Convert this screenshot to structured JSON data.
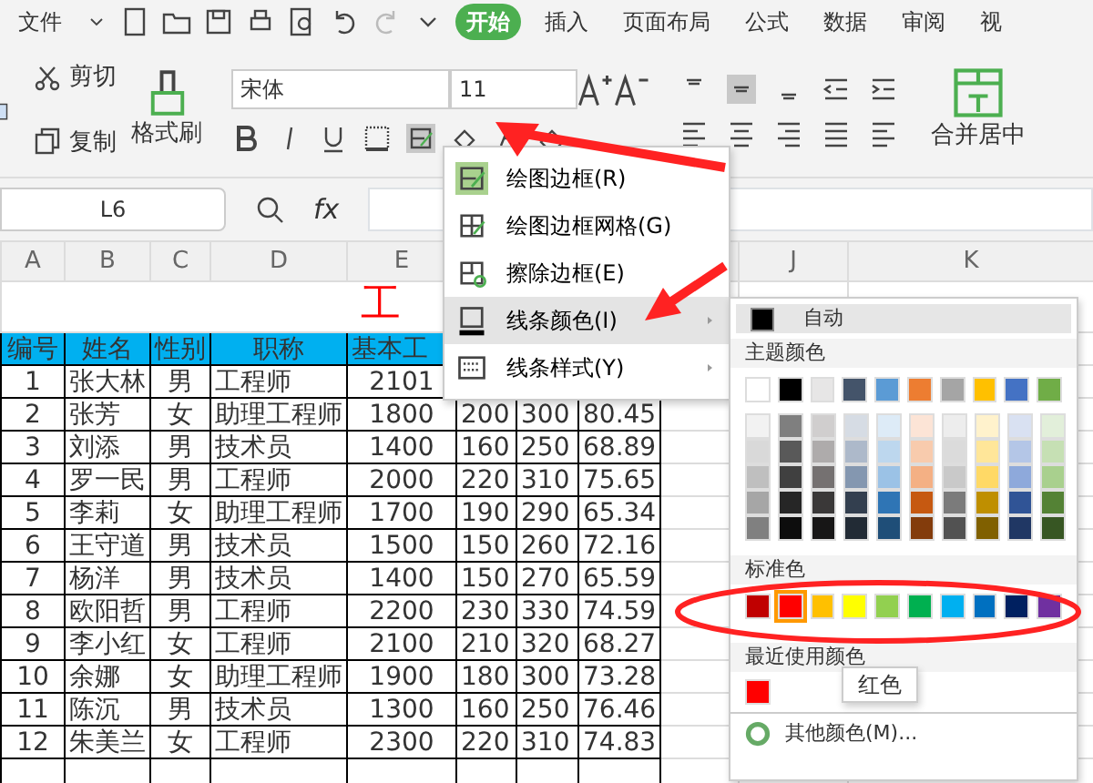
{
  "file_menu": "文件",
  "tabs": [
    {
      "label": "开始",
      "selected": true
    },
    {
      "label": "插入",
      "selected": false
    },
    {
      "label": "页面布局",
      "selected": false
    },
    {
      "label": "公式",
      "selected": false
    },
    {
      "label": "数据",
      "selected": false
    },
    {
      "label": "审阅",
      "selected": false
    },
    {
      "label": "视",
      "selected": false
    }
  ],
  "clipboard": {
    "cut": "剪切",
    "copy": "复制",
    "format_painter": "格式刷"
  },
  "font": {
    "name": "宋体",
    "size": "11"
  },
  "merge": "合并居中",
  "name_box": "L6",
  "fx": "fx",
  "columns": [
    "A",
    "B",
    "C",
    "D",
    "E",
    "J",
    "K"
  ],
  "sheet": {
    "title": "工",
    "headers": [
      "编号",
      "姓名",
      "性别",
      "职称",
      "基本工"
    ],
    "rows": [
      [
        "1",
        "张大林",
        "男",
        "工程师",
        "2101",
        "",
        "",
        ""
      ],
      [
        "2",
        "张芳",
        "女",
        "助理工程师",
        "1800",
        "200",
        "300",
        "80.45"
      ],
      [
        "3",
        "刘添",
        "男",
        "技术员",
        "1400",
        "160",
        "250",
        "68.89"
      ],
      [
        "4",
        "罗一民",
        "男",
        "工程师",
        "2000",
        "220",
        "310",
        "75.65"
      ],
      [
        "5",
        "李莉",
        "女",
        "助理工程师",
        "1700",
        "190",
        "290",
        "65.34"
      ],
      [
        "6",
        "王守道",
        "男",
        "技术员",
        "1500",
        "150",
        "260",
        "72.16"
      ],
      [
        "7",
        "杨洋",
        "男",
        "技术员",
        "1400",
        "150",
        "270",
        "65.59"
      ],
      [
        "8",
        "欧阳哲",
        "男",
        "工程师",
        "2200",
        "230",
        "330",
        "74.59"
      ],
      [
        "9",
        "李小红",
        "女",
        "工程师",
        "2100",
        "210",
        "320",
        "68.27"
      ],
      [
        "10",
        "余娜",
        "女",
        "助理工程师",
        "1900",
        "180",
        "300",
        "73.28"
      ],
      [
        "11",
        "陈沉",
        "男",
        "技术员",
        "1300",
        "160",
        "250",
        "76.46"
      ],
      [
        "12",
        "朱美兰",
        "女",
        "工程师",
        "2300",
        "220",
        "310",
        "74.83"
      ]
    ]
  },
  "border_menu": [
    {
      "label": "绘图边框(R)",
      "active": true,
      "selected": false,
      "submenu": false
    },
    {
      "label": "绘图边框网格(G)",
      "active": false,
      "selected": false,
      "submenu": false
    },
    {
      "label": "擦除边框(E)",
      "active": false,
      "selected": false,
      "submenu": false
    },
    {
      "label": "线条颜色(I)",
      "active": false,
      "selected": true,
      "submenu": true
    },
    {
      "label": "线条样式(Y)",
      "active": false,
      "selected": false,
      "submenu": true
    }
  ],
  "color_panel": {
    "auto": {
      "label": "自动",
      "color": "#000000"
    },
    "theme_label": "主题颜色",
    "theme": [
      {
        "color": "#ffffff",
        "shades": [
          {
            "color": "#f2f2f2"
          },
          {
            "color": "#d9d9d9"
          },
          {
            "color": "#bfbfbf"
          },
          {
            "color": "#a6a6a6"
          },
          {
            "color": "#808080"
          }
        ]
      },
      {
        "color": "#000000",
        "shades": [
          {
            "color": "#7f7f7f"
          },
          {
            "color": "#595959"
          },
          {
            "color": "#404040"
          },
          {
            "color": "#262626"
          },
          {
            "color": "#0d0d0d"
          }
        ]
      },
      {
        "color": "#e7e6e6",
        "shades": [
          {
            "color": "#d0cece"
          },
          {
            "color": "#aeabab"
          },
          {
            "color": "#757171"
          },
          {
            "color": "#3a3838"
          },
          {
            "color": "#171616"
          }
        ]
      },
      {
        "color": "#44546a",
        "shades": [
          {
            "color": "#d6dce4"
          },
          {
            "color": "#adb9ca"
          },
          {
            "color": "#8497b0"
          },
          {
            "color": "#333f4f"
          },
          {
            "color": "#222b35"
          }
        ]
      },
      {
        "color": "#5b9bd5",
        "shades": [
          {
            "color": "#ddebf7"
          },
          {
            "color": "#bdd7ee"
          },
          {
            "color": "#9bc2e6"
          },
          {
            "color": "#2f75b5"
          },
          {
            "color": "#1f4e78"
          }
        ]
      },
      {
        "color": "#ed7d31",
        "shades": [
          {
            "color": "#fce4d6"
          },
          {
            "color": "#f8cbad"
          },
          {
            "color": "#f4b084"
          },
          {
            "color": "#c65911"
          },
          {
            "color": "#833c0c"
          }
        ]
      },
      {
        "color": "#a5a5a5",
        "shades": [
          {
            "color": "#ededed"
          },
          {
            "color": "#dbdbdb"
          },
          {
            "color": "#c9c9c9"
          },
          {
            "color": "#7b7b7b"
          },
          {
            "color": "#525252"
          }
        ]
      },
      {
        "color": "#ffc000",
        "shades": [
          {
            "color": "#fff2cc"
          },
          {
            "color": "#ffe699"
          },
          {
            "color": "#ffd966"
          },
          {
            "color": "#bf8f00"
          },
          {
            "color": "#806000"
          }
        ]
      },
      {
        "color": "#4472c4",
        "shades": [
          {
            "color": "#d9e1f2"
          },
          {
            "color": "#b4c6e7"
          },
          {
            "color": "#8ea9db"
          },
          {
            "color": "#305496"
          },
          {
            "color": "#203764"
          }
        ]
      },
      {
        "color": "#70ad47",
        "shades": [
          {
            "color": "#e2efda"
          },
          {
            "color": "#c6e0b4"
          },
          {
            "color": "#a9d08e"
          },
          {
            "color": "#548235"
          },
          {
            "color": "#375623"
          }
        ]
      }
    ],
    "standard_label": "标准色",
    "standard": [
      {
        "color": "#c00000",
        "selected": false
      },
      {
        "color": "#ff0000",
        "selected": true
      },
      {
        "color": "#ffc000",
        "selected": false
      },
      {
        "color": "#ffff00",
        "selected": false
      },
      {
        "color": "#92d050",
        "selected": false
      },
      {
        "color": "#00b050",
        "selected": false
      },
      {
        "color": "#00b0f0",
        "selected": false
      },
      {
        "color": "#0070c0",
        "selected": false
      },
      {
        "color": "#002060",
        "selected": false
      },
      {
        "color": "#7030a0",
        "selected": false
      }
    ],
    "recent_label": "最近使用颜色",
    "recent": [
      {
        "color": "#ff0000"
      }
    ],
    "more": "其他颜色(M)..."
  },
  "tooltip": "红色"
}
